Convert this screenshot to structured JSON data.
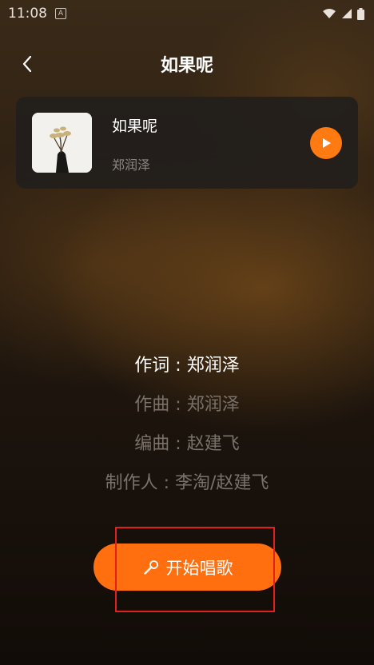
{
  "status_bar": {
    "time": "11:08",
    "notification_icon": "a-box-icon",
    "wifi_icon": "wifi-icon",
    "signal_icon": "signal-icon",
    "battery_icon": "battery-icon"
  },
  "header": {
    "title": "如果呢",
    "back_icon": "chevron-left-icon"
  },
  "song_card": {
    "title": "如果呢",
    "artist": "郑润泽",
    "play_icon": "play-icon"
  },
  "credits": {
    "lyricist": "作词 : 郑润泽",
    "composer": "作曲 : 郑润泽",
    "arranger": "编曲 : 赵建飞",
    "producer": "制作人 : 李淘/赵建飞"
  },
  "start_button": {
    "label": "开始唱歌",
    "icon": "microphone-icon"
  },
  "colors": {
    "accent": "#ff6f0f",
    "highlight_box": "#e3201f"
  }
}
